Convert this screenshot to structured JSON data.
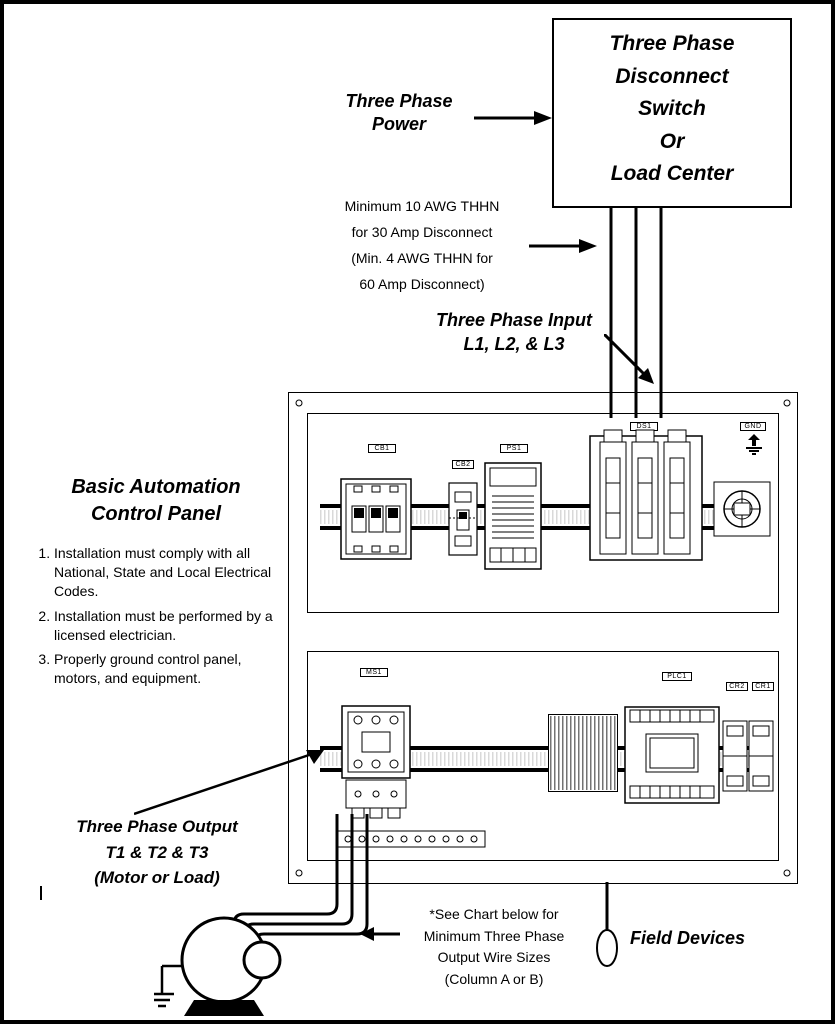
{
  "disconnect_box": {
    "line1": "Three Phase",
    "line2": "Disconnect",
    "line3": "Switch",
    "line4": "Or",
    "line5": "Load Center"
  },
  "labels": {
    "three_phase_power": "Three Phase Power",
    "wire_note_line1": "Minimum 10 AWG THHN",
    "wire_note_line2": "for 30 Amp Disconnect",
    "wire_note_line3": "(Min. 4 AWG THHN for",
    "wire_note_line4": "60 Amp Disconnect)",
    "three_phase_input1": "Three Phase Input",
    "three_phase_input2": "L1, L2, & L3",
    "panel_title1": "Basic Automation",
    "panel_title2": "Control Panel",
    "output1": "Three Phase Output",
    "output2": "T1 & T2 & T3",
    "output3": "(Motor or Load)",
    "field_devices": "Field Devices",
    "output_note1": "*See Chart below for",
    "output_note2": "Minimum Three Phase",
    "output_note3": "Output Wire Sizes",
    "output_note4": "(Column A or B)"
  },
  "ids": {
    "cb1": "CB1",
    "cb2": "CB2",
    "ps1": "PS1",
    "ds1": "DS1",
    "gnd": "GND",
    "ms1": "MS1",
    "plc1": "PLC1",
    "cr2": "CR2",
    "cr1": "CR1"
  },
  "notes": [
    "Installation must comply with all National, State and Local Electrical Codes.",
    "Installation must be performed by a licensed electrician.",
    "Properly ground control panel, motors, and equipment."
  ],
  "chart_data": {
    "type": "diagram",
    "title": "Three Phase Control Panel Wiring Diagram",
    "nodes": [
      {
        "id": "power_source",
        "label": "Three Phase Power"
      },
      {
        "id": "disconnect",
        "label": "Three Phase Disconnect Switch Or Load Center"
      },
      {
        "id": "panel",
        "label": "Basic Automation Control Panel",
        "components": [
          "CB1",
          "CB2",
          "PS1",
          "DS1",
          "GND",
          "MS1",
          "PLC1",
          "CR2",
          "CR1"
        ]
      },
      {
        "id": "motor",
        "label": "Motor or Load"
      },
      {
        "id": "field_devices",
        "label": "Field Devices"
      }
    ],
    "edges": [
      {
        "from": "power_source",
        "to": "disconnect"
      },
      {
        "from": "disconnect",
        "to": "panel",
        "label": "L1, L2, & L3",
        "wire": "Min 10 AWG THHN (30A) / Min 4 AWG THHN (60A)"
      },
      {
        "from": "panel",
        "to": "motor",
        "label": "T1 & T2 & T3",
        "wire": "See chart for minimum three phase output wire sizes (Column A or B)"
      },
      {
        "from": "panel",
        "to": "field_devices"
      }
    ]
  }
}
